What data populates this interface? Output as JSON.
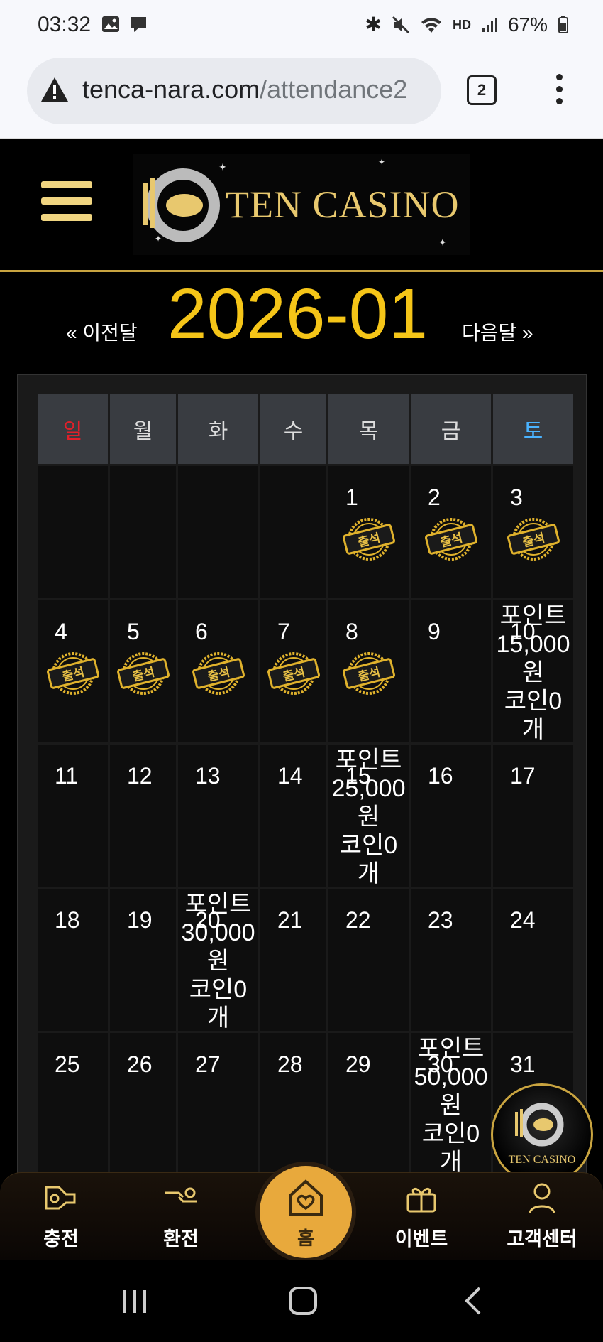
{
  "status_bar": {
    "time": "03:32",
    "battery": "67%"
  },
  "browser": {
    "url_host": "tenca-nara.com",
    "url_path": "/attendance2",
    "tab_count": "2"
  },
  "header": {
    "logo_text": "TEN CASINO"
  },
  "month_nav": {
    "prev_label": "« 이전달",
    "month": "2026-01",
    "next_label": "다음달 »"
  },
  "calendar": {
    "weekdays": [
      "일",
      "월",
      "화",
      "수",
      "목",
      "금",
      "토"
    ],
    "stamp_label": "출석",
    "weeks": [
      [
        {
          "day": ""
        },
        {
          "day": ""
        },
        {
          "day": ""
        },
        {
          "day": ""
        },
        {
          "day": "1",
          "stamp": true
        },
        {
          "day": "2",
          "stamp": true
        },
        {
          "day": "3",
          "stamp": true
        }
      ],
      [
        {
          "day": "4",
          "stamp": true
        },
        {
          "day": "5",
          "stamp": true
        },
        {
          "day": "6",
          "stamp": true
        },
        {
          "day": "7",
          "stamp": true
        },
        {
          "day": "8",
          "stamp": true
        },
        {
          "day": "9"
        },
        {
          "day": "10",
          "reward": "포인트\n15,000\n원\n코인0\n개"
        }
      ],
      [
        {
          "day": "11"
        },
        {
          "day": "12"
        },
        {
          "day": "13"
        },
        {
          "day": "14"
        },
        {
          "day": "15",
          "reward": "포인트\n25,000\n원\n코인0\n개"
        },
        {
          "day": "16"
        },
        {
          "day": "17"
        }
      ],
      [
        {
          "day": "18"
        },
        {
          "day": "19"
        },
        {
          "day": "20",
          "reward": "포인트\n30,000\n원\n코인0\n개"
        },
        {
          "day": "21"
        },
        {
          "day": "22"
        },
        {
          "day": "23"
        },
        {
          "day": "24"
        }
      ],
      [
        {
          "day": "25"
        },
        {
          "day": "26"
        },
        {
          "day": "27"
        },
        {
          "day": "28"
        },
        {
          "day": "29"
        },
        {
          "day": "30",
          "reward": "포인트\n50,000\n원\n코인0\n개"
        },
        {
          "day": "31"
        }
      ]
    ]
  },
  "floating_badge": {
    "logo_text": "TEN CASINO"
  },
  "bottom_nav": {
    "charge": "충전",
    "exchange": "환전",
    "home": "홈",
    "events": "이벤트",
    "support": "고객센터"
  },
  "colors": {
    "accent_gold": "#f5c518",
    "sunday": "#e0202a",
    "saturday": "#4ab3ff"
  }
}
